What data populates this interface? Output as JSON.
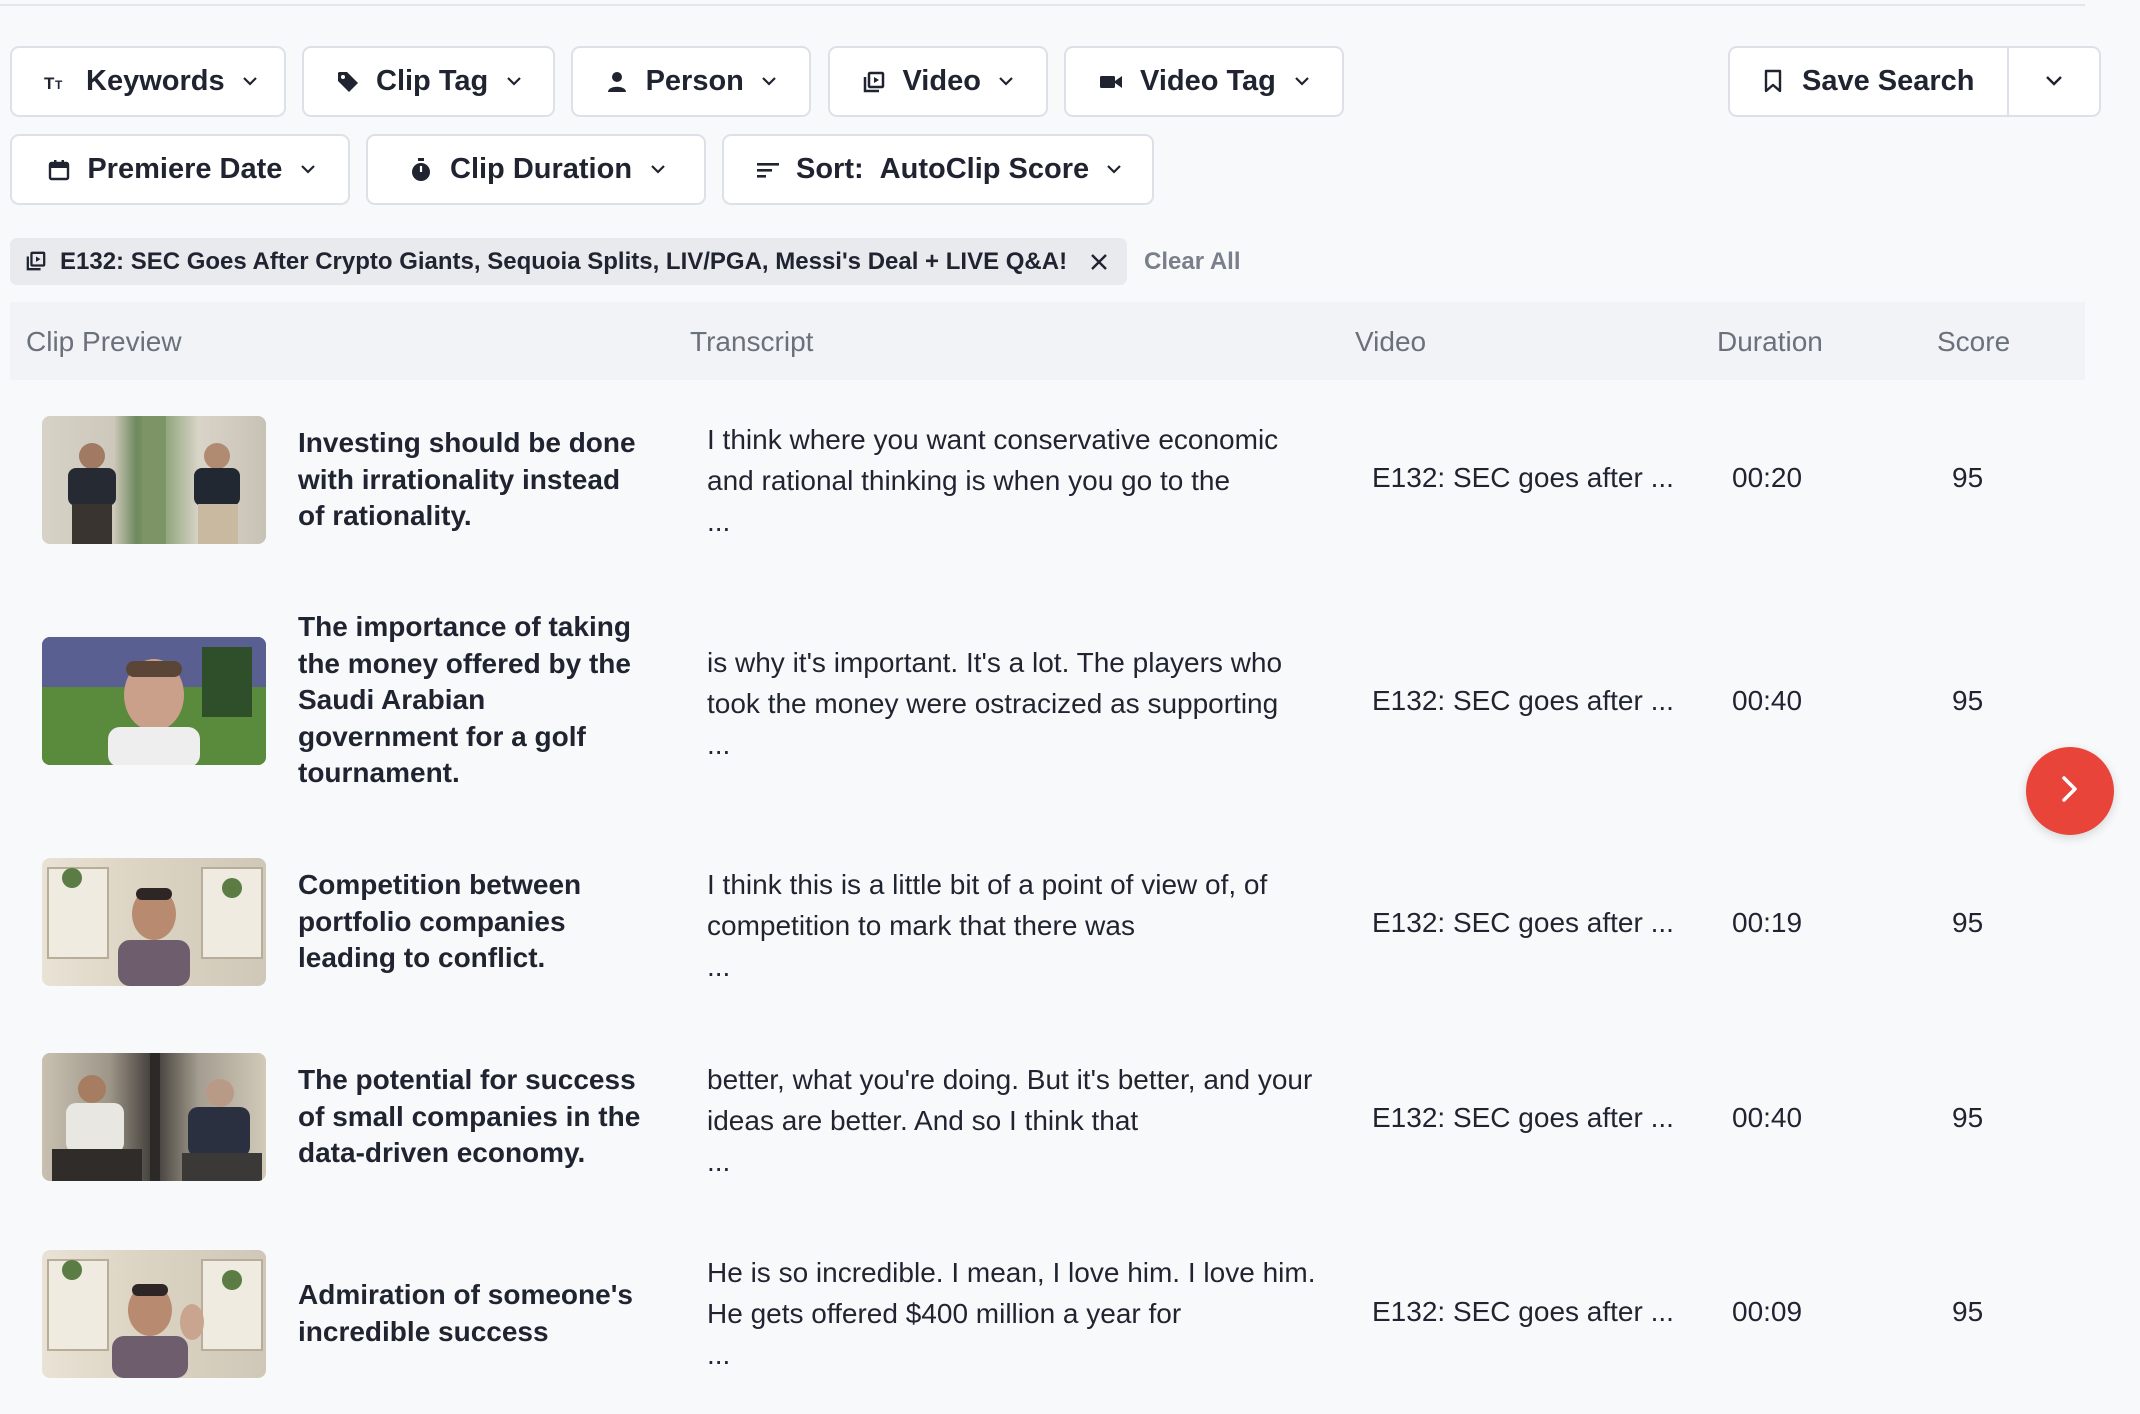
{
  "filters": {
    "keywords": "Keywords",
    "clip_tag": "Clip Tag",
    "person": "Person",
    "video": "Video",
    "video_tag": "Video Tag",
    "premiere_date": "Premiere Date",
    "clip_duration": "Clip Duration",
    "sort_prefix": "Sort:",
    "sort_value": "AutoClip Score"
  },
  "save_search": {
    "label": "Save Search"
  },
  "active_filter": {
    "label": "E132: SEC Goes After Crypto Giants, Sequoia Splits, LIV/PGA, Messi's Deal + LIVE Q&A!"
  },
  "clear_all": "Clear All",
  "table": {
    "headers": {
      "preview": "Clip Preview",
      "transcript": "Transcript",
      "video": "Video",
      "duration": "Duration",
      "score": "Score"
    },
    "rows": [
      {
        "title": "Investing should be done with irrationality instead of rationality.",
        "transcript": "I think where you want conservative economic and rational thinking is when you go to the",
        "ellipsis": "...",
        "video": "E132: SEC goes after ...",
        "duration": "00:20",
        "score": "95"
      },
      {
        "title": "The importance of taking the money offered by the Saudi Arabian government for a golf tournament.",
        "transcript": "is why it's important. It's a lot. The players who took the money were ostracized as supporting",
        "ellipsis": "...",
        "video": "E132: SEC goes after ...",
        "duration": "00:40",
        "score": "95"
      },
      {
        "title": "Competition between portfolio companies leading to conflict.",
        "transcript": "I think this is a little bit of a point of view of, of competition to mark that there was",
        "ellipsis": "...",
        "video": "E132: SEC goes after ...",
        "duration": "00:19",
        "score": "95"
      },
      {
        "title": "The potential for success of small companies in the data-driven economy.",
        "transcript": "better, what you're doing. But it's better, and your ideas are better. And so I think that",
        "ellipsis": "...",
        "video": "E132: SEC goes after ...",
        "duration": "00:40",
        "score": "95"
      },
      {
        "title": "Admiration of someone's incredible success",
        "transcript": "He is so incredible. I mean, I love him. I love him. He gets offered $400 million a year for",
        "ellipsis": "...",
        "video": "E132: SEC goes after ...",
        "duration": "00:09",
        "score": "95"
      }
    ]
  },
  "colors": {
    "accent": "#e8443a",
    "border": "#dde1e7",
    "muted_text": "#6b717c"
  }
}
